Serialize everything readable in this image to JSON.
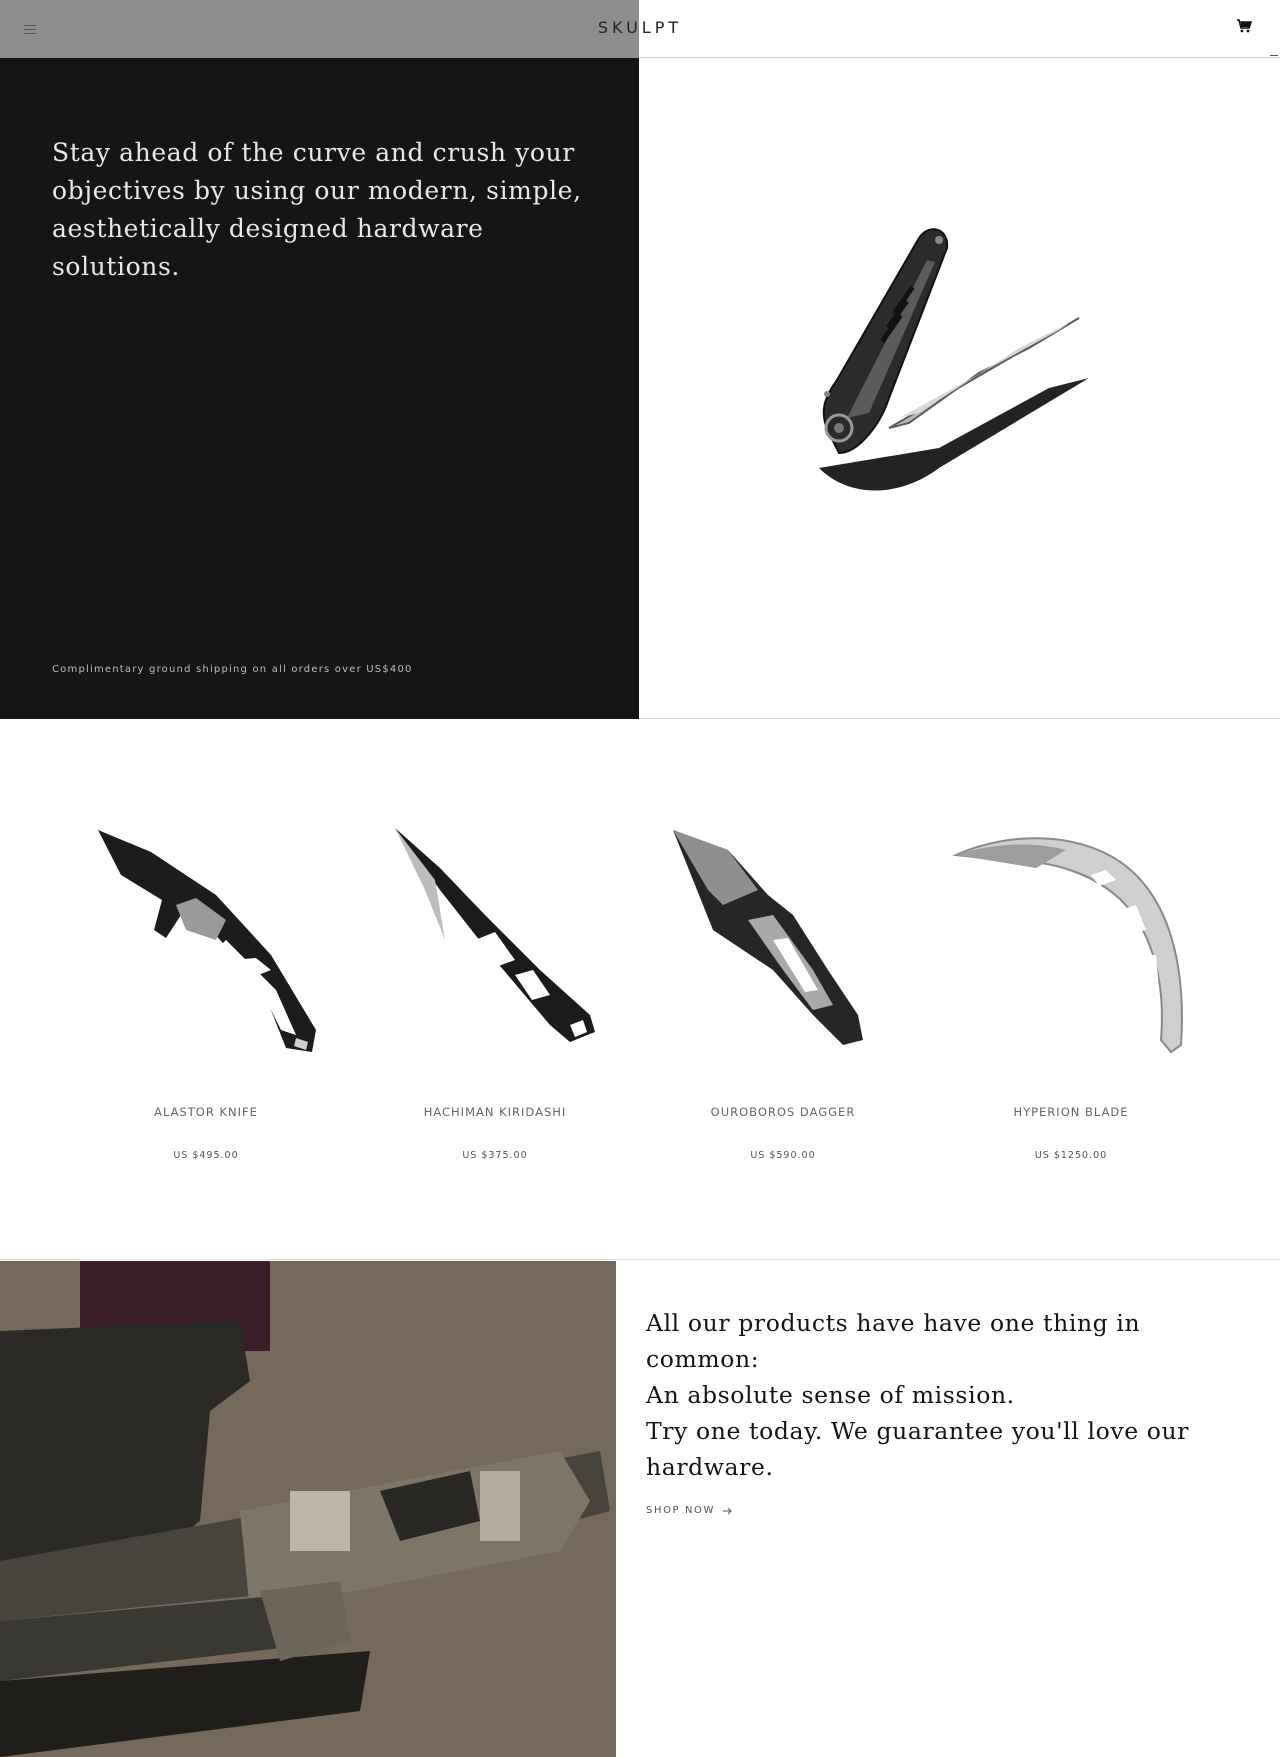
{
  "header": {
    "brand": "SKULPT",
    "menu_icon": "hamburger-icon",
    "cart_icon": "shopping-cart-icon"
  },
  "hero": {
    "headline": "Stay ahead of the curve and crush your objectives by using our modern, simple, aesthetically designed hardware solutions.",
    "shipping_note": "Complimentary ground shipping on all orders over US$400",
    "image": "folding-knife-image"
  },
  "products": [
    {
      "name": "ALASTOR KNIFE",
      "price": "US $495.00"
    },
    {
      "name": "HACHIMAN KIRIDASHI",
      "price": "US $375.00"
    },
    {
      "name": "OUROBOROS DAGGER",
      "price": "US $590.00"
    },
    {
      "name": "HYPERION BLADE",
      "price": "US $1250.00"
    }
  ],
  "story": {
    "lines": [
      "All our products have have one thing in common:",
      "An absolute sense of mission.",
      "Try one today. We guarantee you'll love our hardware."
    ],
    "cta": "SHOP NOW",
    "cta_icon": "arrow-right-icon",
    "image": "rifle-muzzle-image"
  },
  "colors": {
    "hero_dark": "#151516",
    "header_dim": "#8e8e8e",
    "text_dark": "#141414"
  }
}
